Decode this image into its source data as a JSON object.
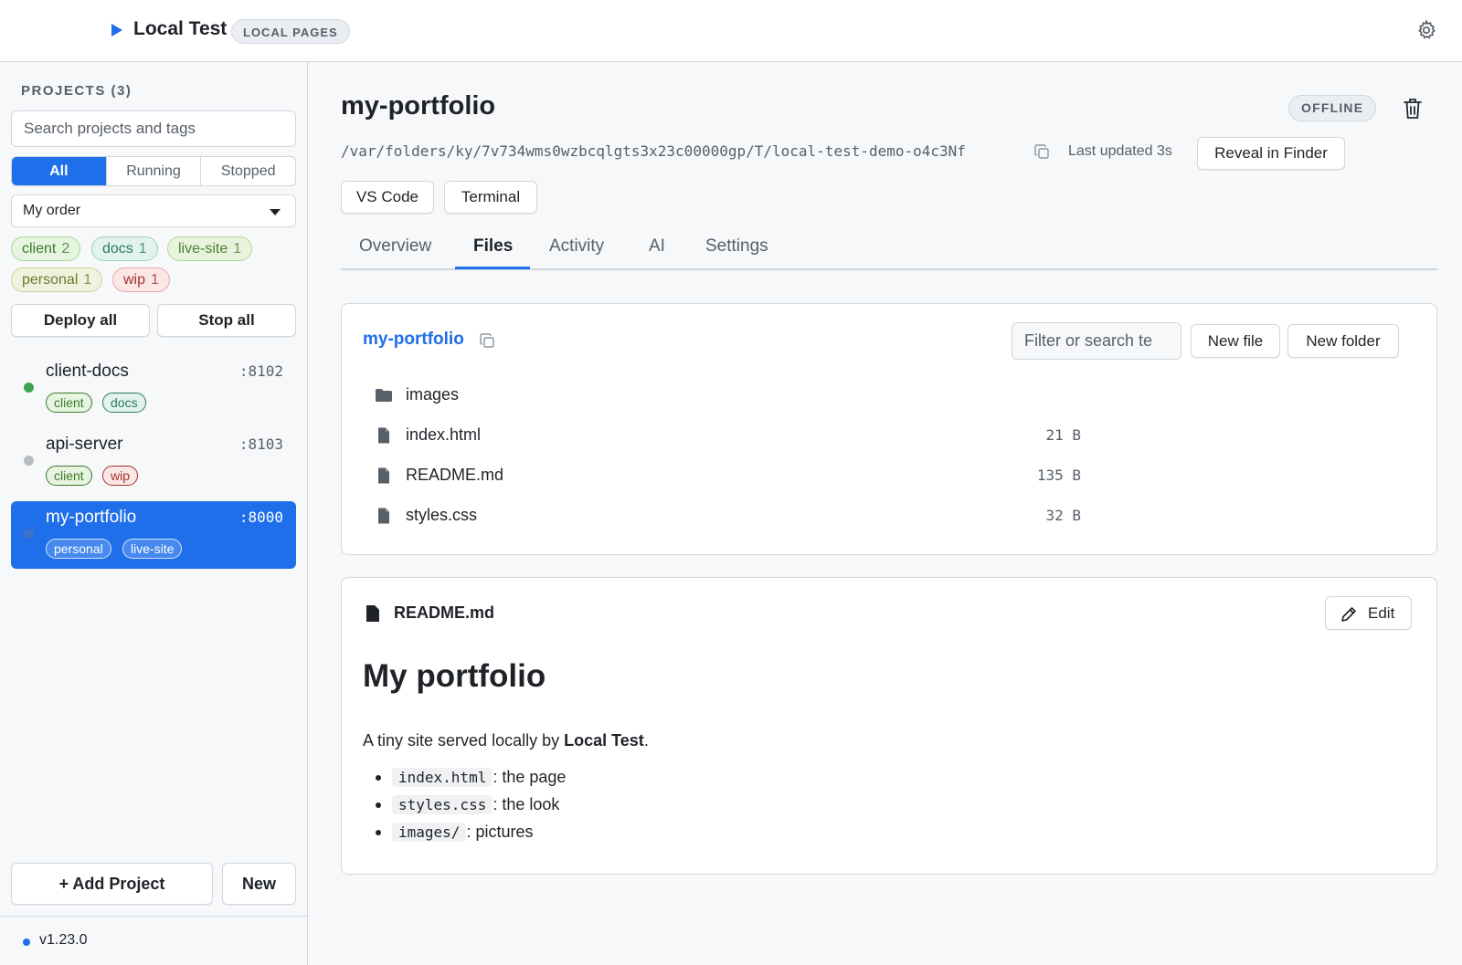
{
  "app": {
    "title": "Local Test",
    "badge": "LOCAL PAGES"
  },
  "sidebar": {
    "heading": "PROJECTS (3)",
    "search_placeholder": "Search projects and tags",
    "filters": [
      "All",
      "Running",
      "Stopped"
    ],
    "active_filter": "All",
    "order": "My order",
    "tags": [
      {
        "name": "client",
        "count": "2"
      },
      {
        "name": "docs",
        "count": "1"
      },
      {
        "name": "live-site",
        "count": "1"
      },
      {
        "name": "personal",
        "count": "1"
      },
      {
        "name": "wip",
        "count": "1"
      }
    ],
    "deploy_all": "Deploy all",
    "stop_all": "Stop all",
    "projects": [
      {
        "name": "client-docs",
        "port": ":8102",
        "status": "running",
        "tags": [
          "client",
          "docs"
        ]
      },
      {
        "name": "api-server",
        "port": ":8103",
        "status": "stopped",
        "tags": [
          "client",
          "wip"
        ]
      },
      {
        "name": "my-portfolio",
        "port": ":8000",
        "status": "stopped",
        "tags": [
          "personal",
          "live-site"
        ],
        "selected": true
      }
    ],
    "add_project": "+ Add Project",
    "new": "New",
    "version": "v1.23.0"
  },
  "project": {
    "title": "my-portfolio",
    "status": "OFFLINE",
    "path": "/var/folders/ky/7v734wms0wzbcqlgts3x23c00000gp/T/local-test-demo-o4c3Nf",
    "last_updated": "Last updated 3s",
    "reveal": "Reveal in Finder",
    "open_buttons": [
      "VS Code",
      "Terminal"
    ],
    "tabs": [
      "Overview",
      "Files",
      "Activity",
      "AI",
      "Settings"
    ],
    "active_tab": "Files"
  },
  "files": {
    "crumb": "my-portfolio",
    "filter_placeholder": "Filter or search te",
    "new_file": "New file",
    "new_folder": "New folder",
    "items": [
      {
        "name": "images",
        "kind": "folder",
        "size": ""
      },
      {
        "name": "index.html",
        "kind": "file",
        "size": "21 B"
      },
      {
        "name": "README.md",
        "kind": "file",
        "size": "135 B"
      },
      {
        "name": "styles.css",
        "kind": "file",
        "size": "32 B"
      }
    ]
  },
  "readme": {
    "file": "README.md",
    "edit": "Edit",
    "heading": "My portfolio",
    "para_prefix": "A tiny site served locally by ",
    "para_bold": "Local Test",
    "para_suffix": ".",
    "items": [
      {
        "code": "index.html",
        "text": ": the page"
      },
      {
        "code": "styles.css",
        "text": ": the look"
      },
      {
        "code": "images/",
        "text": ": pictures"
      }
    ]
  },
  "colors": {
    "accent": "#1f6feb",
    "running": "#3fa34d",
    "stopped": "#b8bcc2"
  }
}
